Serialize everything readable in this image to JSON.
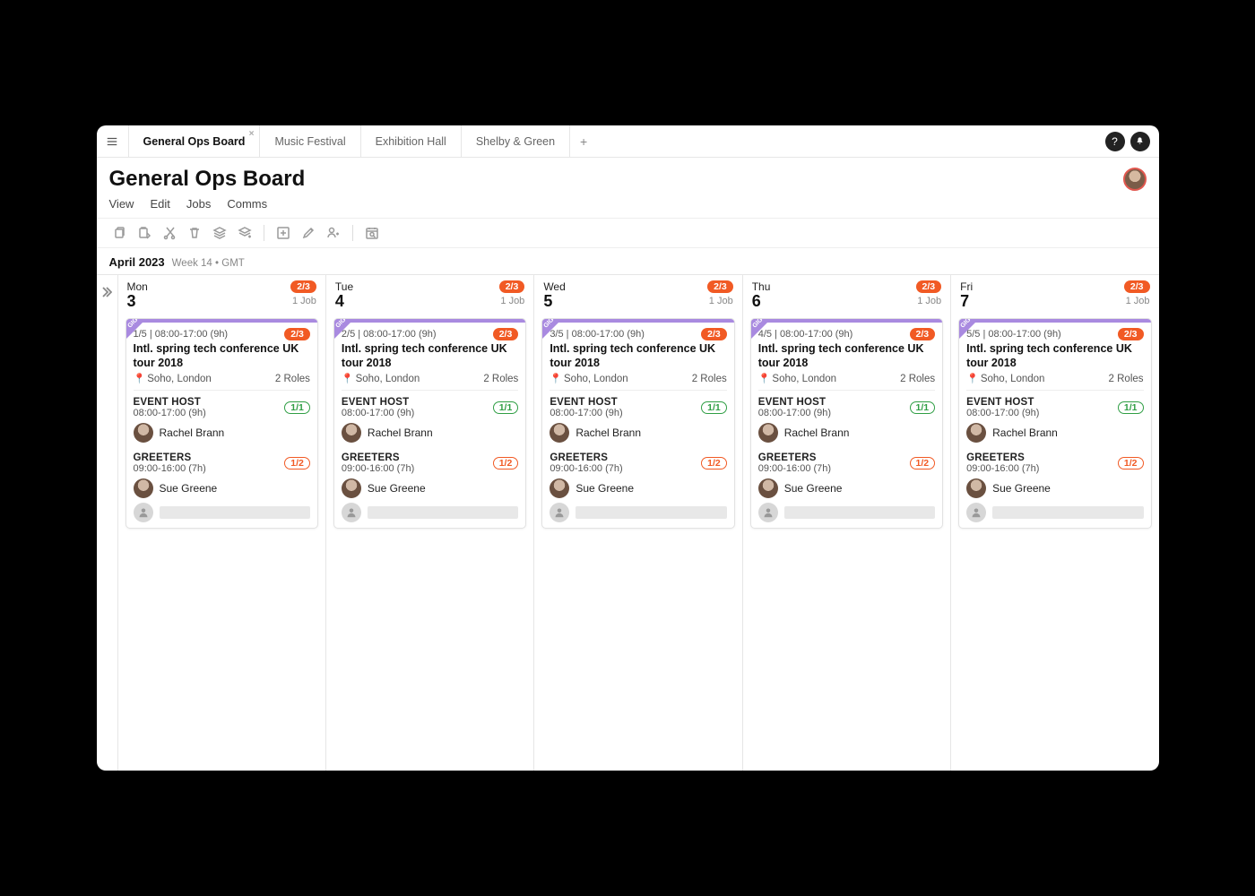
{
  "tabs": [
    {
      "label": "General Ops Board",
      "active": true
    },
    {
      "label": "Music Festival"
    },
    {
      "label": "Exhibition Hall"
    },
    {
      "label": "Shelby & Green"
    }
  ],
  "page": {
    "title": "General Ops Board",
    "menu": [
      "View",
      "Edit",
      "Jobs",
      "Comms"
    ],
    "month": "April 2023",
    "meta": "Week 14  •  GMT"
  },
  "days": [
    {
      "dow": "Mon",
      "num": "3",
      "badge": "2/3",
      "jobs": "1 Job",
      "gig": "1/5 | 08:00-17:00 (9h)"
    },
    {
      "dow": "Tue",
      "num": "4",
      "badge": "2/3",
      "jobs": "1 Job",
      "gig": "2/5 | 08:00-17:00 (9h)"
    },
    {
      "dow": "Wed",
      "num": "5",
      "badge": "2/3",
      "jobs": "1 Job",
      "gig": "3/5 | 08:00-17:00 (9h)"
    },
    {
      "dow": "Thu",
      "num": "6",
      "badge": "2/3",
      "jobs": "1 Job",
      "gig": "4/5 | 08:00-17:00 (9h)"
    },
    {
      "dow": "Fri",
      "num": "7",
      "badge": "2/3",
      "jobs": "1 Job",
      "gig": "5/5 | 08:00-17:00 (9h)"
    }
  ],
  "job": {
    "title": "Intl. spring tech conference UK tour 2018",
    "location": "Soho, London",
    "roles_count": "2 Roles",
    "headbadge": "2/3",
    "corner": "GIG",
    "roles": [
      {
        "name": "EVENT HOST",
        "time": "08:00-17:00 (9h)",
        "pill": "1/1",
        "pillcls": "green",
        "people": [
          "Rachel Brann"
        ],
        "empty": 0
      },
      {
        "name": "GREETERS",
        "time": "09:00-16:00 (7h)",
        "pill": "1/2",
        "pillcls": "orange",
        "people": [
          "Sue Greene"
        ],
        "empty": 1
      }
    ]
  }
}
